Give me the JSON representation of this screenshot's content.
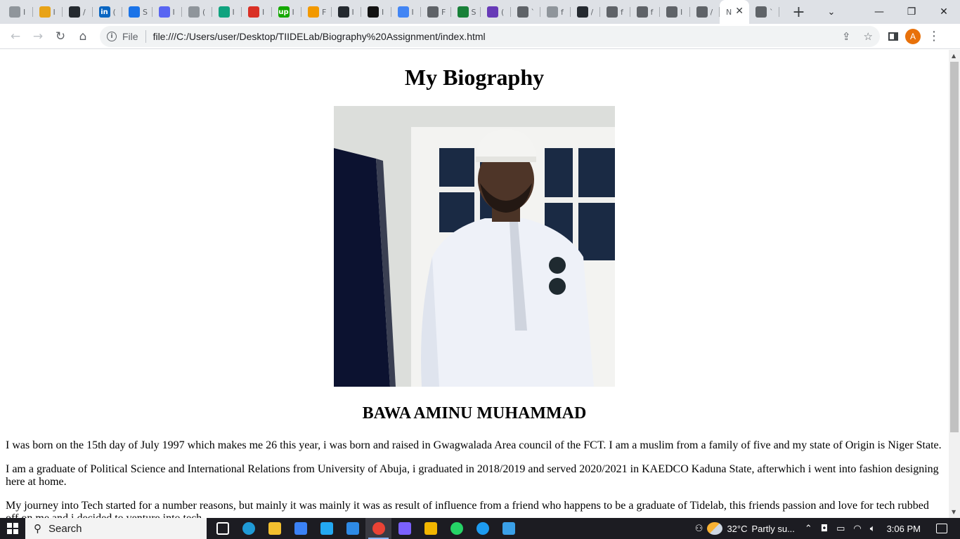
{
  "browser": {
    "tabs": [
      {
        "icon": "generic-page",
        "color": "#8f959b",
        "glyph": "",
        "label": "I"
      },
      {
        "icon": "chart-app",
        "color": "#e8a317",
        "glyph": "",
        "label": "I"
      },
      {
        "icon": "github",
        "color": "#24292f",
        "glyph": "",
        "label": "/"
      },
      {
        "icon": "linkedin",
        "color": "#0a66c2",
        "glyph": "in",
        "label": "("
      },
      {
        "icon": "ring-app",
        "color": "#1a73e8",
        "glyph": "",
        "label": "S"
      },
      {
        "icon": "discord",
        "color": "#5865f2",
        "glyph": "",
        "label": "I"
      },
      {
        "icon": "book",
        "color": "#8f959b",
        "glyph": "",
        "label": "("
      },
      {
        "icon": "chatgpt",
        "color": "#10a37f",
        "glyph": "",
        "label": "I"
      },
      {
        "icon": "tag-app",
        "color": "#d93025",
        "glyph": "",
        "label": "I"
      },
      {
        "icon": "upwork",
        "color": "#14a800",
        "glyph": "up",
        "label": "I"
      },
      {
        "icon": "spark-app",
        "color": "#f29900",
        "glyph": "",
        "label": "F"
      },
      {
        "icon": "github",
        "color": "#24292f",
        "glyph": "",
        "label": "I"
      },
      {
        "icon": "dark-app",
        "color": "#111111",
        "glyph": "",
        "label": "I"
      },
      {
        "icon": "diamond-app",
        "color": "#4285f4",
        "glyph": "",
        "label": "I"
      },
      {
        "icon": "globe",
        "color": "#5f6368",
        "glyph": "",
        "label": "F"
      },
      {
        "icon": "green-app",
        "color": "#188038",
        "glyph": "",
        "label": "S"
      },
      {
        "icon": "list-app",
        "color": "#673ab7",
        "glyph": "",
        "label": "("
      },
      {
        "icon": "globe",
        "color": "#5f6368",
        "glyph": "",
        "label": "`"
      },
      {
        "icon": "flag",
        "color": "#8f959b",
        "glyph": "",
        "label": "f"
      },
      {
        "icon": "github",
        "color": "#24292f",
        "glyph": "",
        "label": "/"
      },
      {
        "icon": "puzzle",
        "color": "#5f6368",
        "glyph": "",
        "label": "f"
      },
      {
        "icon": "chrome-web",
        "color": "#5f6368",
        "glyph": "",
        "label": "f"
      },
      {
        "icon": "globe",
        "color": "#5f6368",
        "glyph": "",
        "label": "I"
      },
      {
        "icon": "globe",
        "color": "#5f6368",
        "glyph": "",
        "label": "/"
      }
    ],
    "active_tab_label": "N",
    "trailing_tab_label": "`",
    "url_scheme": "File",
    "url": "file:///C:/Users/user/Desktop/TIIDELab/Biography%20Assignment/index.html",
    "avatar_letter": "A"
  },
  "page": {
    "title": "My Biography",
    "photo_alt": "Portrait photo",
    "name": "BAWA AMINU MUHAMMAD",
    "paragraphs": [
      "I was born on the 15th day of July 1997 which makes me 26 this year, i was born and raised in Gwagwalada Area council of the FCT. I am a muslim from a family of five and my state of Origin is Niger State.",
      "I am a graduate of Political Science and International Relations from University of Abuja, i graduated in 2018/2019 and served 2020/2021 in KAEDCO Kaduna State, afterwhich i went into fashion designing here at home.",
      "My journey into Tech started for a number reasons, but mainly it was mainly it was as result of influence from a friend who happens to be a graduate of Tidelab, this friends passion and love for tech rubbed off on me and i decided to venture into tech."
    ]
  },
  "taskbar": {
    "search_label": "Search",
    "apps": [
      {
        "icon": "task-view",
        "color": "#ffffff"
      },
      {
        "icon": "edge",
        "color": "#1f9ad6"
      },
      {
        "icon": "file-explorer",
        "color": "#f3c02f"
      },
      {
        "icon": "store",
        "color": "#3b82f6"
      },
      {
        "icon": "vscode",
        "color": "#23a9f2"
      },
      {
        "icon": "mail",
        "color": "#2e8ae6"
      },
      {
        "icon": "chrome",
        "color": "#ea4335"
      },
      {
        "icon": "app-purple",
        "color": "#7b61ff"
      },
      {
        "icon": "media",
        "color": "#f2b600"
      },
      {
        "icon": "whatsapp",
        "color": "#25d366"
      },
      {
        "icon": "twitter",
        "color": "#1d9bf0"
      },
      {
        "icon": "notes",
        "color": "#3aa0e8"
      }
    ],
    "weather_temp": "32°C",
    "weather_text": "Partly su...",
    "time": "3:06 PM"
  }
}
